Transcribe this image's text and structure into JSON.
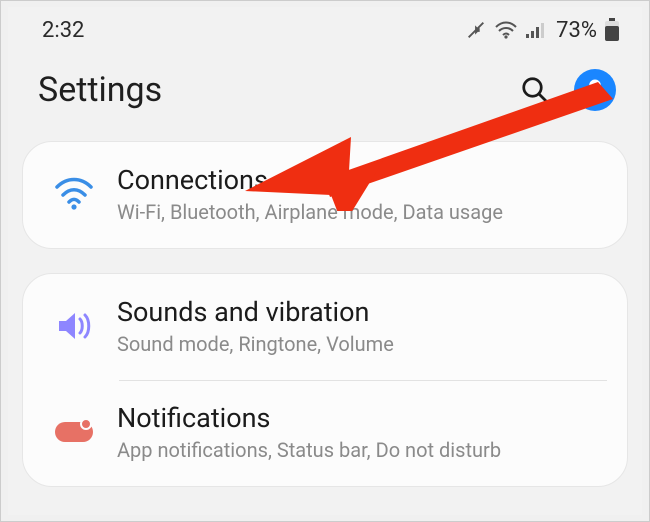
{
  "status": {
    "time": "2:32",
    "battery_pct": "73%"
  },
  "header": {
    "title": "Settings"
  },
  "groups": [
    {
      "items": [
        {
          "key": "connections",
          "title": "Connections",
          "subtitle": "Wi-Fi, Bluetooth, Airplane mode, Data usage"
        }
      ]
    },
    {
      "items": [
        {
          "key": "sounds",
          "title": "Sounds and vibration",
          "subtitle": "Sound mode, Ringtone, Volume"
        },
        {
          "key": "notifications",
          "title": "Notifications",
          "subtitle": "App notifications, Status bar, Do not disturb"
        }
      ]
    }
  ],
  "colors": {
    "accent_blue": "#3a8ee6",
    "accent_purple": "#8e86ff",
    "accent_coral": "#e77165",
    "avatar_bg": "#1a86ff",
    "arrow": "#ef2e11"
  }
}
